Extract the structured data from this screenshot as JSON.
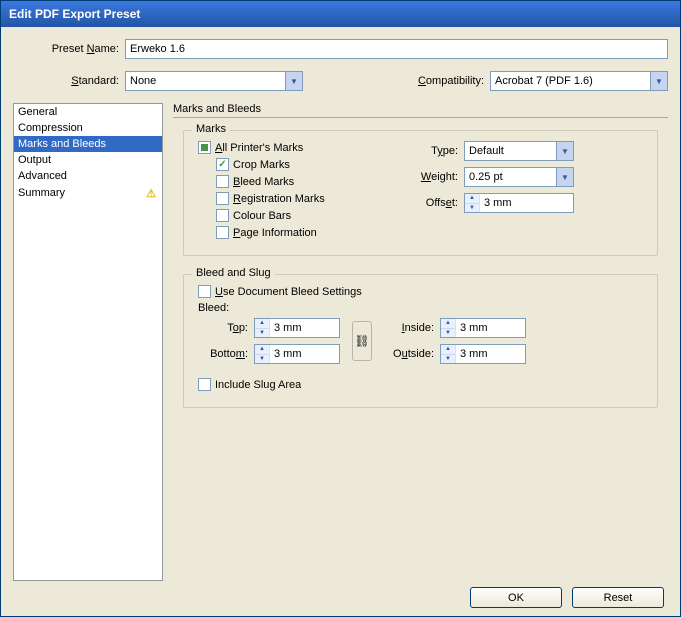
{
  "window": {
    "title": "Edit PDF Export Preset"
  },
  "header": {
    "presetLabel": "Preset Name:",
    "presetValue": "Erweko 1.6",
    "standardLabel": "Standard:",
    "standardValue": "None",
    "compatLabel": "Compatibility:",
    "compatValue": "Acrobat 7 (PDF 1.6)"
  },
  "sidebar": {
    "items": [
      "General",
      "Compression",
      "Marks and Bleeds",
      "Output",
      "Advanced",
      "Summary"
    ],
    "selectedIndex": 2,
    "warnIndex": 5
  },
  "panel": {
    "title": "Marks and Bleeds",
    "marks": {
      "group": "Marks",
      "allPrinters": "All Printer's Marks",
      "cropMarks": "Crop Marks",
      "bleedMarks": "Bleed Marks",
      "registrationMarks": "Registration Marks",
      "colourBars": "Colour Bars",
      "pageInfo": "Page Information",
      "typeLabel": "Type:",
      "typeValue": "Default",
      "weightLabel": "Weight:",
      "weightValue": "0.25 pt",
      "offsetLabel": "Offset:",
      "offsetValue": "3 mm",
      "state": {
        "allPrinters": "mixed",
        "cropMarks": true,
        "bleedMarks": false,
        "registrationMarks": false,
        "colourBars": false,
        "pageInfo": false
      }
    },
    "bleed": {
      "group": "Bleed and Slug",
      "useDocBleed": "Use Document Bleed Settings",
      "useDocBleedChecked": false,
      "bleedLabel": "Bleed:",
      "topLabel": "Top:",
      "topValue": "3 mm",
      "bottomLabel": "Bottom:",
      "bottomValue": "3 mm",
      "insideLabel": "Inside:",
      "insideValue": "3 mm",
      "outsideLabel": "Outside:",
      "outsideValue": "3 mm",
      "includeSlug": "Include Slug Area",
      "includeSlugChecked": false
    }
  },
  "buttons": {
    "ok": "OK",
    "reset": "Reset"
  }
}
